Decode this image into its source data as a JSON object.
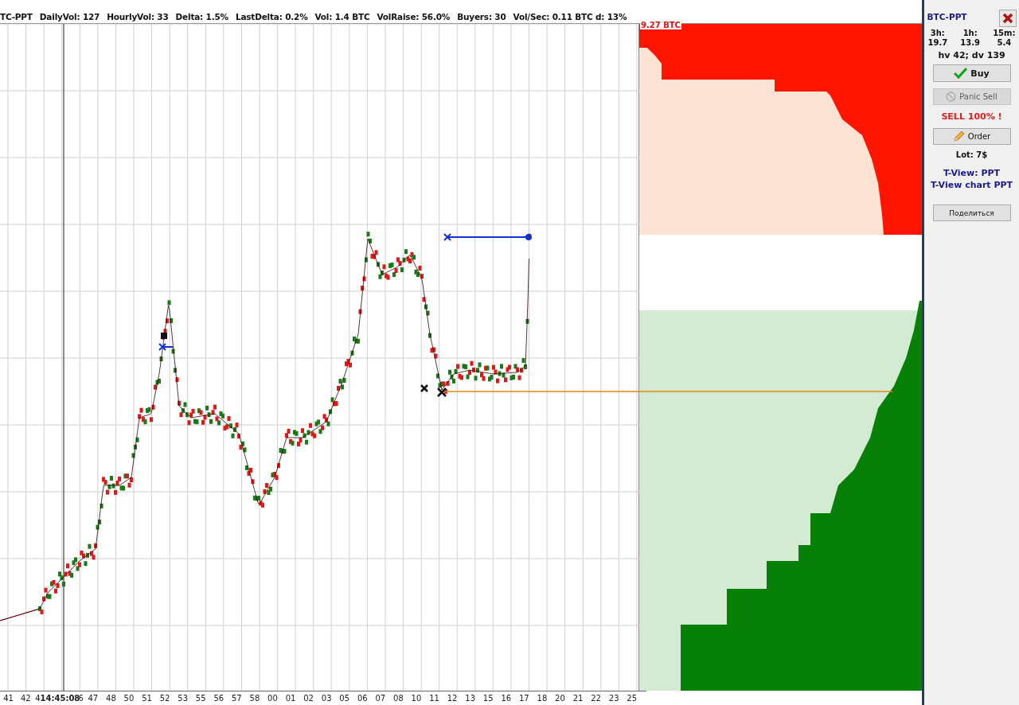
{
  "header": {
    "items": [
      "TC-PPT",
      "DailyVol: 127",
      "HourlyVol: 33",
      "Delta: 1.5%",
      "LastDelta: 0.2%",
      "Vol: 1.4 BTC",
      "VolRaise: 56.0%",
      "Buyers: 30",
      "Vol/Sec: 0.11 BTC d: 13%"
    ]
  },
  "order_book": {
    "top_volume": "9.27 BTC"
  },
  "time_axis": {
    "ticks": [
      {
        "label": "41",
        "kind": "tick"
      },
      {
        "label": "42",
        "kind": "tick"
      },
      {
        "label": "4",
        "kind": "cut"
      },
      {
        "label": "14:45:08",
        "kind": "cursor"
      },
      {
        "label": "6",
        "kind": "cut"
      },
      {
        "label": "47",
        "kind": "tick"
      },
      {
        "label": "48",
        "kind": "tick"
      },
      {
        "label": "50",
        "kind": "tick"
      },
      {
        "label": "51",
        "kind": "tick"
      },
      {
        "label": "52",
        "kind": "tick"
      },
      {
        "label": "53",
        "kind": "tick"
      },
      {
        "label": "55",
        "kind": "tick"
      },
      {
        "label": "56",
        "kind": "tick"
      },
      {
        "label": "57",
        "kind": "tick"
      },
      {
        "label": "58",
        "kind": "tick"
      },
      {
        "label": "00",
        "kind": "tick"
      },
      {
        "label": "01",
        "kind": "tick"
      },
      {
        "label": "02",
        "kind": "tick"
      },
      {
        "label": "03",
        "kind": "tick"
      },
      {
        "label": "05",
        "kind": "tick"
      },
      {
        "label": "06",
        "kind": "tick"
      },
      {
        "label": "07",
        "kind": "tick"
      },
      {
        "label": "08",
        "kind": "tick"
      },
      {
        "label": "10",
        "kind": "tick"
      },
      {
        "label": "11",
        "kind": "tick"
      },
      {
        "label": "12",
        "kind": "tick"
      },
      {
        "label": "13",
        "kind": "tick"
      },
      {
        "label": "15",
        "kind": "tick"
      },
      {
        "label": "16",
        "kind": "tick"
      },
      {
        "label": "17",
        "kind": "tick"
      },
      {
        "label": "18",
        "kind": "tick"
      },
      {
        "label": "20",
        "kind": "tick"
      },
      {
        "label": "21",
        "kind": "tick"
      },
      {
        "label": "22",
        "kind": "tick"
      },
      {
        "label": "23",
        "kind": "tick"
      },
      {
        "label": "25",
        "kind": "tick"
      }
    ]
  },
  "panel": {
    "symbol": "BTC-PPT",
    "periods": [
      {
        "label": "3h:",
        "value": "19.7"
      },
      {
        "label": "1h:",
        "value": "13.9"
      },
      {
        "label": "15m:",
        "value": "5.4"
      }
    ],
    "volumes": "hv 42; dv 139",
    "buy_button": {
      "label": "Buy",
      "disabled": false
    },
    "panic_button": {
      "label": "Panic Sell",
      "disabled": true
    },
    "signal": "SELL 100% !",
    "order_button": {
      "label": "Order",
      "disabled": false
    },
    "lot": "Lot: 7$",
    "links": [
      "T-View: PPT",
      "T-View chart PPT"
    ],
    "share_button": {
      "label": "Поделиться",
      "disabled": false
    }
  }
}
